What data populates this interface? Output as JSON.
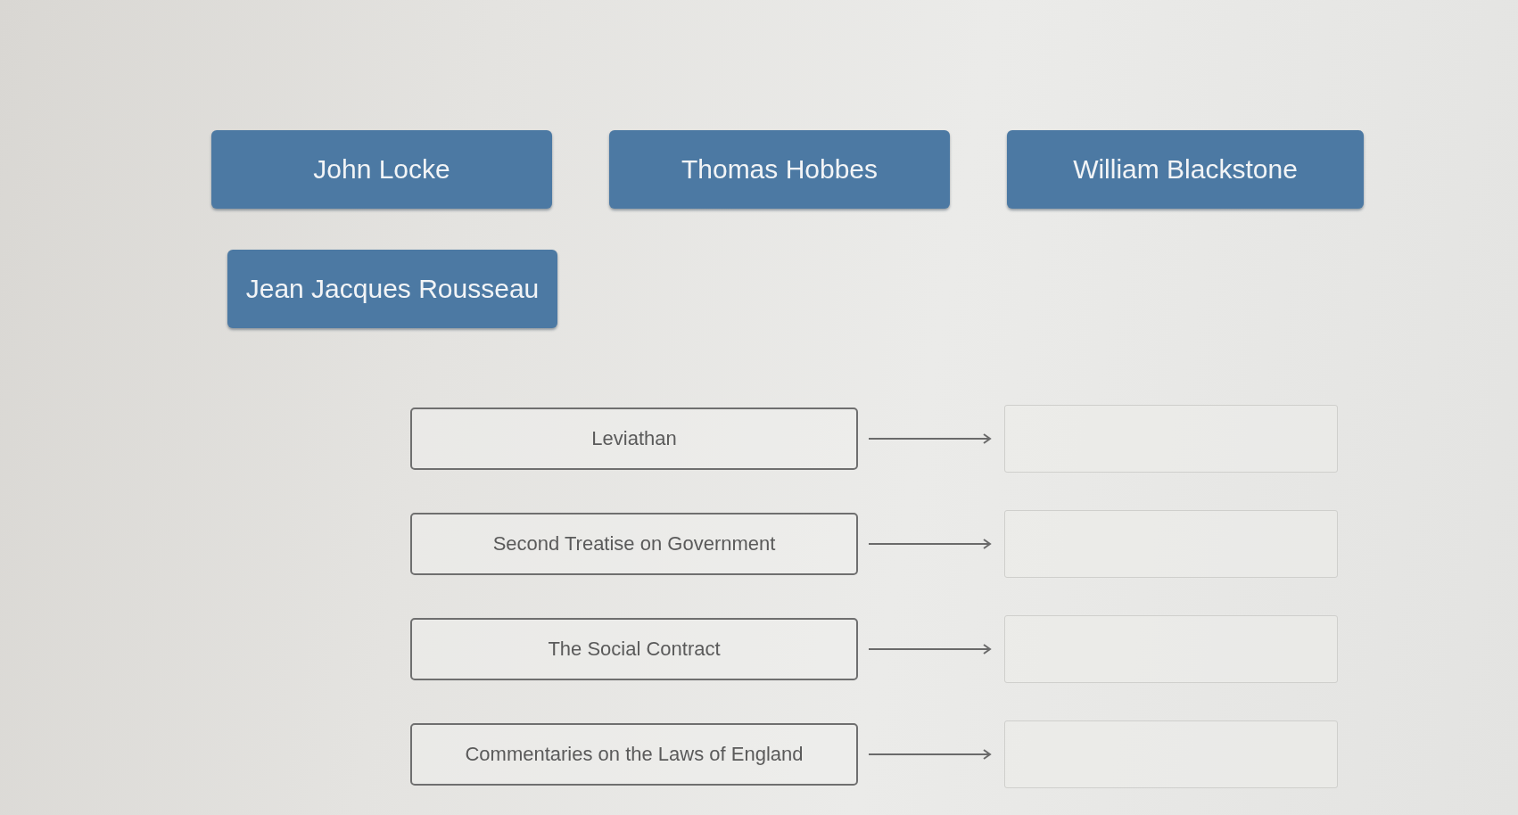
{
  "tiles": [
    {
      "label": "John Locke"
    },
    {
      "label": "Thomas Hobbes"
    },
    {
      "label": "William Blackstone"
    },
    {
      "label": "Jean Jacques Rousseau"
    }
  ],
  "rows": [
    {
      "book": "Leviathan"
    },
    {
      "book": "Second Treatise on Government"
    },
    {
      "book": "The Social Contract"
    },
    {
      "book": "Commentaries on the Laws of England"
    }
  ]
}
